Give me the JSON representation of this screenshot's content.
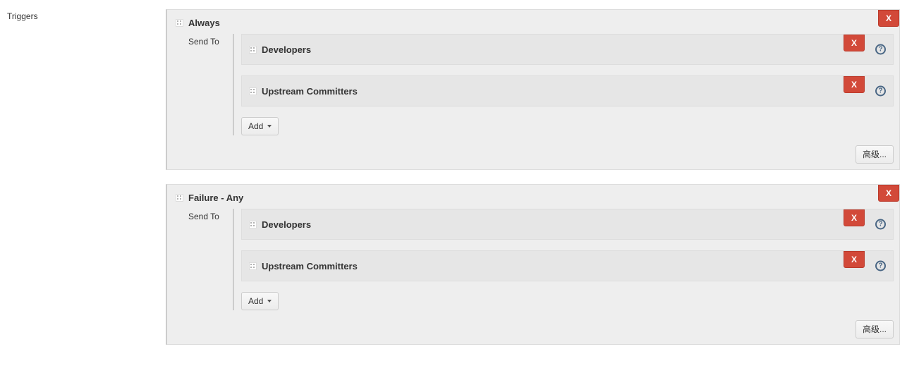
{
  "sidebar": {
    "triggers_label": "Triggers"
  },
  "buttons": {
    "delete": "X",
    "add": "Add",
    "advanced": "高级...",
    "help_glyph": "?"
  },
  "triggers": [
    {
      "title": "Always",
      "send_to_label": "Send To",
      "recipients": [
        {
          "name": "Developers"
        },
        {
          "name": "Upstream Committers"
        }
      ]
    },
    {
      "title": "Failure - Any",
      "send_to_label": "Send To",
      "recipients": [
        {
          "name": "Developers"
        },
        {
          "name": "Upstream Committers"
        }
      ]
    }
  ]
}
